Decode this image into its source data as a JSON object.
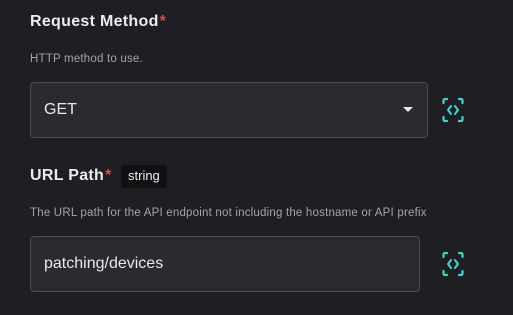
{
  "request_method": {
    "label": "Request Method",
    "required_mark": "*",
    "help": "HTTP method to use.",
    "selected_value": "GET",
    "toggle_icon": "code-brackets-icon",
    "accent": "#3dd6cf"
  },
  "url_path": {
    "label": "URL Path",
    "required_mark": "*",
    "type_badge": "string",
    "help": "The URL path for the API endpoint not including the hostname or API prefix",
    "value": "patching/devices",
    "toggle_icon": "code-brackets-icon",
    "accent": "#3dd6cf"
  }
}
